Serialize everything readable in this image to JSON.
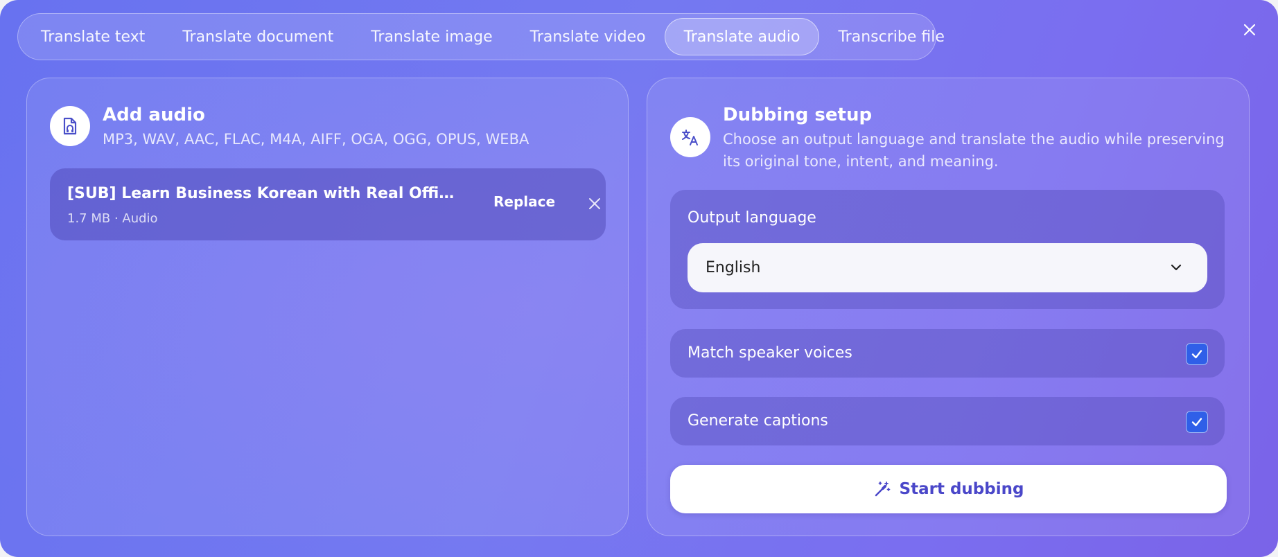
{
  "tabs": [
    {
      "label": "Translate text",
      "active": false
    },
    {
      "label": "Translate document",
      "active": false
    },
    {
      "label": "Translate image",
      "active": false
    },
    {
      "label": "Translate video",
      "active": false
    },
    {
      "label": "Translate audio",
      "active": true
    },
    {
      "label": "Transcribe file",
      "active": false
    }
  ],
  "left": {
    "title": "Add audio",
    "formats": "MP3, WAV, AAC, FLAC, M4A, AIFF, OGA, OGG, OPUS, WEBA",
    "icon": "audio-file-icon",
    "file": {
      "name": "[SUB] Learn Business Korean with Real Office Conversations",
      "meta": "1.7 MB · Audio",
      "replace_label": "Replace"
    }
  },
  "right": {
    "title": "Dubbing setup",
    "description": "Choose an output language and translate the audio while preserving its original tone, intent, and meaning.",
    "icon": "translate-icon",
    "output_language": {
      "label": "Output language",
      "value": "English"
    },
    "options": [
      {
        "label": "Match speaker voices",
        "checked": true
      },
      {
        "label": "Generate captions",
        "checked": true
      }
    ],
    "start_label": "Start dubbing",
    "start_icon": "magic-wand-icon"
  },
  "colors": {
    "accent": "#2f5fe8",
    "button_text": "#4a47c9",
    "modal_gradient_start": "#6872f0",
    "modal_gradient_end": "#7a63e8"
  }
}
